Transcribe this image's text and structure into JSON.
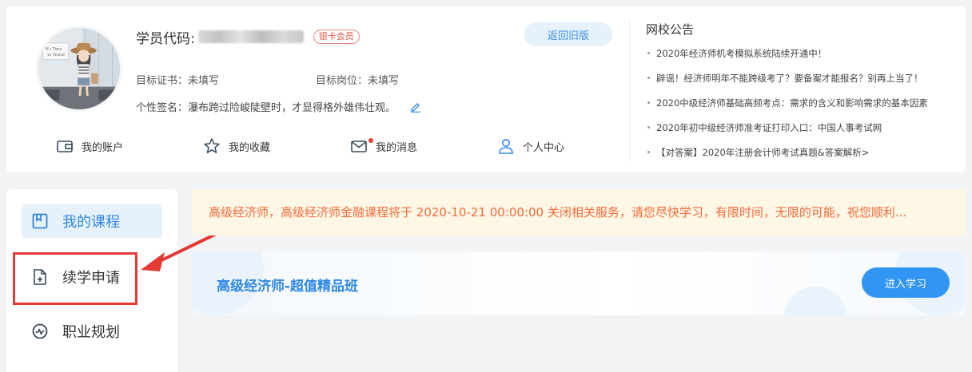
{
  "profile": {
    "student_code_label": "学员代码:",
    "member_badge": "银卡会员",
    "back_button": "返回旧版",
    "target_cert": "目标证书：未填写",
    "target_position": "目标岗位：未填写",
    "signature": "个性签名：瀑布跨过险峻陡壁时，才显得格外雄伟壮观。"
  },
  "quick_nav": [
    {
      "label": "我的账户",
      "icon": "wallet-icon"
    },
    {
      "label": "我的收藏",
      "icon": "star-icon"
    },
    {
      "label": "我的消息",
      "icon": "mail-icon"
    },
    {
      "label": "个人中心",
      "icon": "user-icon"
    }
  ],
  "notices": {
    "title": "网校公告",
    "items": [
      "2020年经济师机考模拟系统陆续开通中！",
      "辟谣！经济师明年不能跨级考了？要备案才能报名？别再上当了！",
      "2020中级经济师基础高频考点：需求的含义和影响需求的基本因素",
      "2020年初中级经济师准考证打印入口：中国人事考试网",
      "【对答案】2020年注册会计师考试真题&答案解析>"
    ]
  },
  "sidebar": {
    "items": [
      {
        "label": "我的课程",
        "icon": "bookmark-icon"
      },
      {
        "label": "续学申请",
        "icon": "file-add-icon"
      },
      {
        "label": "职业规划",
        "icon": "pulse-icon"
      }
    ]
  },
  "banner": {
    "text": "高级经济师，高级经济师金融课程将于 2020-10-21 00:00:00 关闭相关服务，请您尽快学习，有限时间，无限的可能，祝您顺利..."
  },
  "course": {
    "title": "高级经济师-超值精品班",
    "button": "进入学习"
  },
  "colors": {
    "accent": "#2f87e4",
    "button": "#3196f3",
    "banner_text": "#f26b3a",
    "highlight": "#e53935"
  }
}
